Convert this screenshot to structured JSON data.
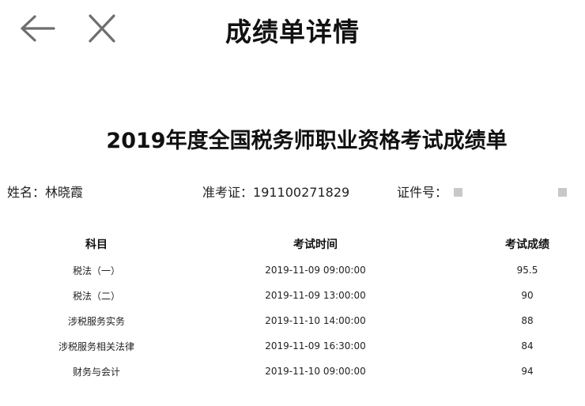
{
  "header": {
    "title": "成绩单详情",
    "back_icon": "arrow-left-icon",
    "close_icon": "close-icon"
  },
  "document": {
    "title": "2019年度全国税务师职业资格考试成绩单"
  },
  "info": {
    "name_label": "姓名：",
    "name_value": "林晓霞",
    "exam_no_label": "准考证：",
    "exam_no_value": "191100271829",
    "id_label": "证件号："
  },
  "table": {
    "headers": [
      "科目",
      "考试时间",
      "考试成绩"
    ],
    "rows": [
      {
        "subject": "税法（一）",
        "time": "2019-11-09 09:00:00",
        "score": "95.5"
      },
      {
        "subject": "税法（二）",
        "time": "2019-11-09 13:00:00",
        "score": "90"
      },
      {
        "subject": "涉税服务实务",
        "time": "2019-11-10 14:00:00",
        "score": "88"
      },
      {
        "subject": "涉税服务相关法律",
        "time": "2019-11-09 16:30:00",
        "score": "84"
      },
      {
        "subject": "财务与会计",
        "time": "2019-11-10 09:00:00",
        "score": "94"
      }
    ]
  },
  "colors": {
    "icon": "#6e6e6e",
    "text": "#111111",
    "redaction": "#c8c8c8"
  }
}
